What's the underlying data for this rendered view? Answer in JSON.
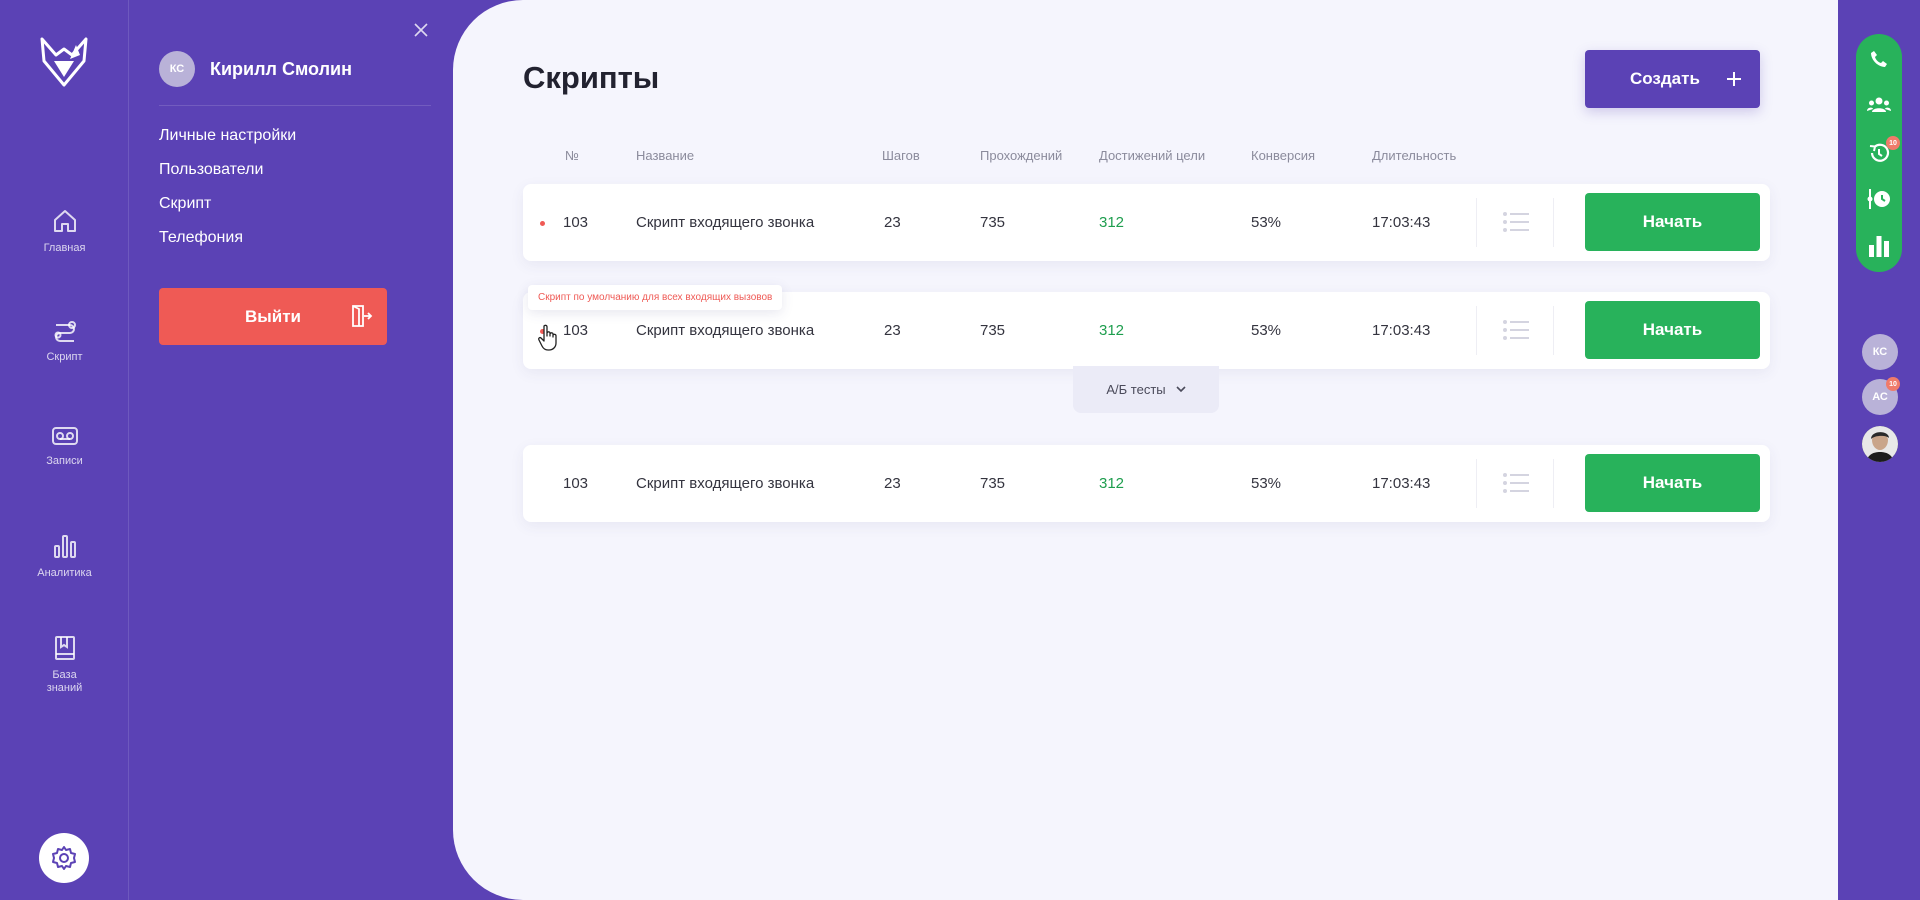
{
  "rail": {
    "logo_icon": "fox-logo-icon",
    "items": [
      {
        "label": "Главная",
        "icon": "home-icon"
      },
      {
        "label": "Скрипт",
        "icon": "script-icon"
      },
      {
        "label": "Записи",
        "icon": "voicemail-icon"
      },
      {
        "label": "Аналитика",
        "icon": "bar-chart-icon"
      },
      {
        "label": "База\nзнаний",
        "icon": "book-icon"
      }
    ],
    "settings_icon": "gear-icon"
  },
  "drawer": {
    "user": {
      "initials": "КС",
      "name": "Кирилл Смолин"
    },
    "menu": [
      "Личные настройки",
      "Пользователи",
      "Скрипт",
      "Телефония"
    ],
    "logout_label": "Выйти"
  },
  "main": {
    "title": "Скрипты",
    "create_label": "Создать",
    "columns": [
      "№",
      "Название",
      "Шагов",
      "Прохождений",
      "Достижений цели",
      "Конверсия",
      "Длительность"
    ],
    "rows": [
      {
        "num": "103",
        "name": "Скрипт входящего звонка",
        "steps": "23",
        "passes": "735",
        "goals": "312",
        "conversion": "53%",
        "duration": "17:03:43",
        "start_label": "Начать"
      },
      {
        "num": "103",
        "name": "Скрипт входящего звонка",
        "steps": "23",
        "passes": "735",
        "goals": "312",
        "conversion": "53%",
        "duration": "17:03:43",
        "start_label": "Начать"
      },
      {
        "num": "103",
        "name": "Скрипт входящего звонка",
        "steps": "23",
        "passes": "735",
        "goals": "312",
        "conversion": "53%",
        "duration": "17:03:43",
        "start_label": "Начать"
      }
    ],
    "tooltip": "Скрипт по умолчанию для всех входящих вызовов",
    "ab_label": "А/Б тесты"
  },
  "right_bar": {
    "icons": [
      "phone-icon",
      "users-icon",
      "history-icon",
      "timeline-clock-icon",
      "bar-chart-icon"
    ],
    "history_badge": "10",
    "avatars": [
      {
        "initials": "КС"
      },
      {
        "initials": "АС",
        "badge": "10"
      }
    ]
  },
  "colors": {
    "primary": "#5b42b5",
    "success": "#28b25b",
    "danger": "#ef5a55",
    "background": "#f5f5fd"
  }
}
